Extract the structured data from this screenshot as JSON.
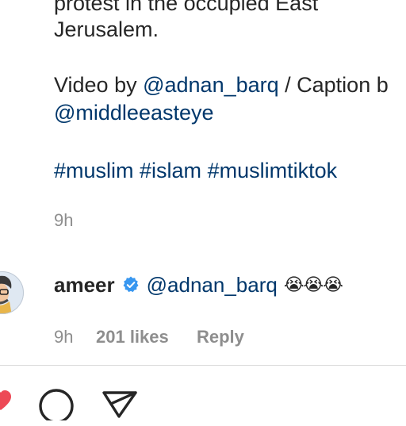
{
  "caption": {
    "line1": "protest in the occupied East",
    "line2": "Jerusalem.",
    "credit_prefix": "Video by ",
    "credit_mention1": "@adnan_barq",
    "credit_middle": " / Caption b",
    "credit_mention2": "@middleeasteye",
    "hashtags": [
      "#muslim",
      "#islam",
      "#muslimtiktok"
    ],
    "time": "9h"
  },
  "comment": {
    "username": "ameer",
    "mention": "@adnan_barq",
    "emojis": "😭😭😭",
    "time": "9h",
    "likes": "201 likes",
    "reply_label": "Reply"
  },
  "colors": {
    "link": "#00376b",
    "verified": "#3897f0",
    "muted": "#8e8e8e",
    "like_red": "#ed4956"
  },
  "icons": [
    "verified-badge-icon",
    "heart-icon",
    "comment-icon",
    "share-icon"
  ]
}
